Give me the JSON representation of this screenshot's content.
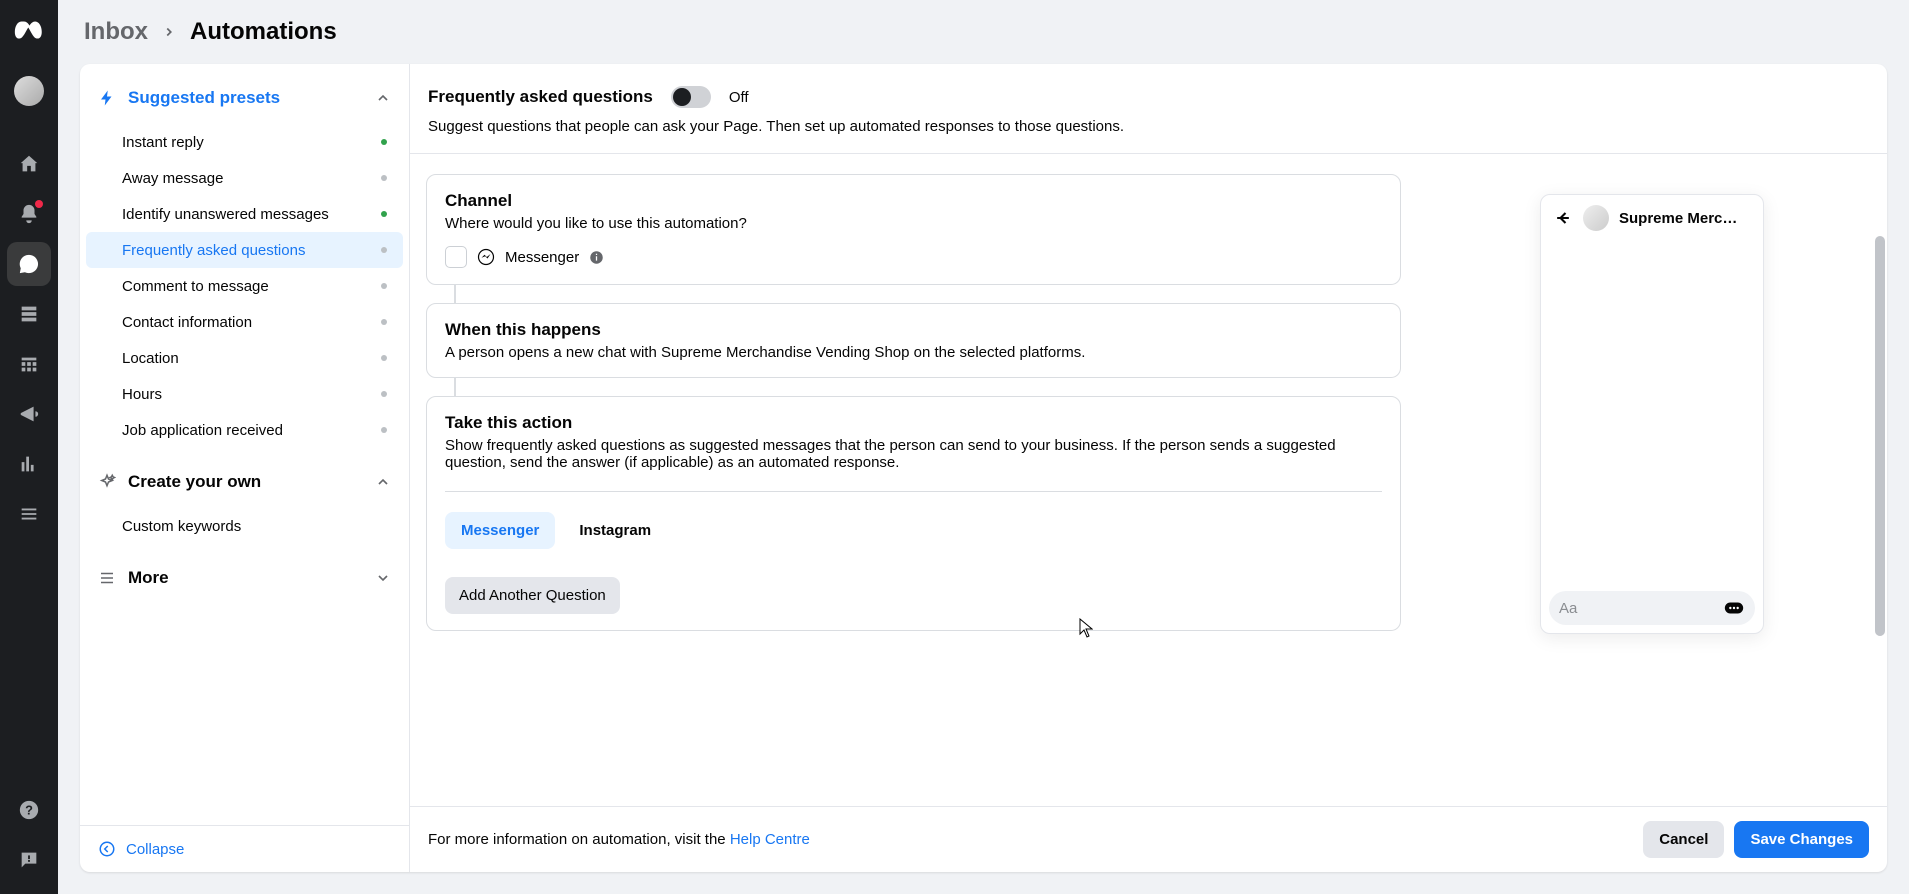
{
  "breadcrumbs": {
    "a": "Inbox",
    "b": "Automations"
  },
  "sidebar": {
    "suggested": "Suggested presets",
    "create": "Create your own",
    "more": "More",
    "collapse": "Collapse",
    "custom": "Custom keywords",
    "items": [
      {
        "label": "Instant reply",
        "on": true
      },
      {
        "label": "Away message",
        "on": false
      },
      {
        "label": "Identify unanswered messages",
        "on": true
      },
      {
        "label": "Frequently asked questions",
        "on": false,
        "active": true
      },
      {
        "label": "Comment to message",
        "on": false
      },
      {
        "label": "Contact information",
        "on": false
      },
      {
        "label": "Location",
        "on": false
      },
      {
        "label": "Hours",
        "on": false
      },
      {
        "label": "Job application received",
        "on": false
      }
    ]
  },
  "head": {
    "title": "Frequently asked questions",
    "toggle": "Off",
    "desc": "Suggest questions that people can ask your Page. Then set up automated responses to those questions."
  },
  "channel": {
    "title": "Channel",
    "sub": "Where would you like to use this automation?",
    "opt": "Messenger"
  },
  "when": {
    "title": "When this happens",
    "sub": "A person opens a new chat with Supreme Merchandise Vending Shop on the selected platforms."
  },
  "action": {
    "title": "Take this action",
    "sub": "Show frequently asked questions as suggested messages that the person can send to your business. If the person sends a suggested question, send the answer (if applicable) as an automated response.",
    "tab1": "Messenger",
    "tab2": "Instagram",
    "add": "Add Another Question"
  },
  "preview": {
    "name": "Supreme Merc…",
    "placeholder": "Aa"
  },
  "footer": {
    "info": "For more information on automation, visit the ",
    "link": "Help Centre",
    "cancel": "Cancel",
    "save": "Save Changes"
  }
}
